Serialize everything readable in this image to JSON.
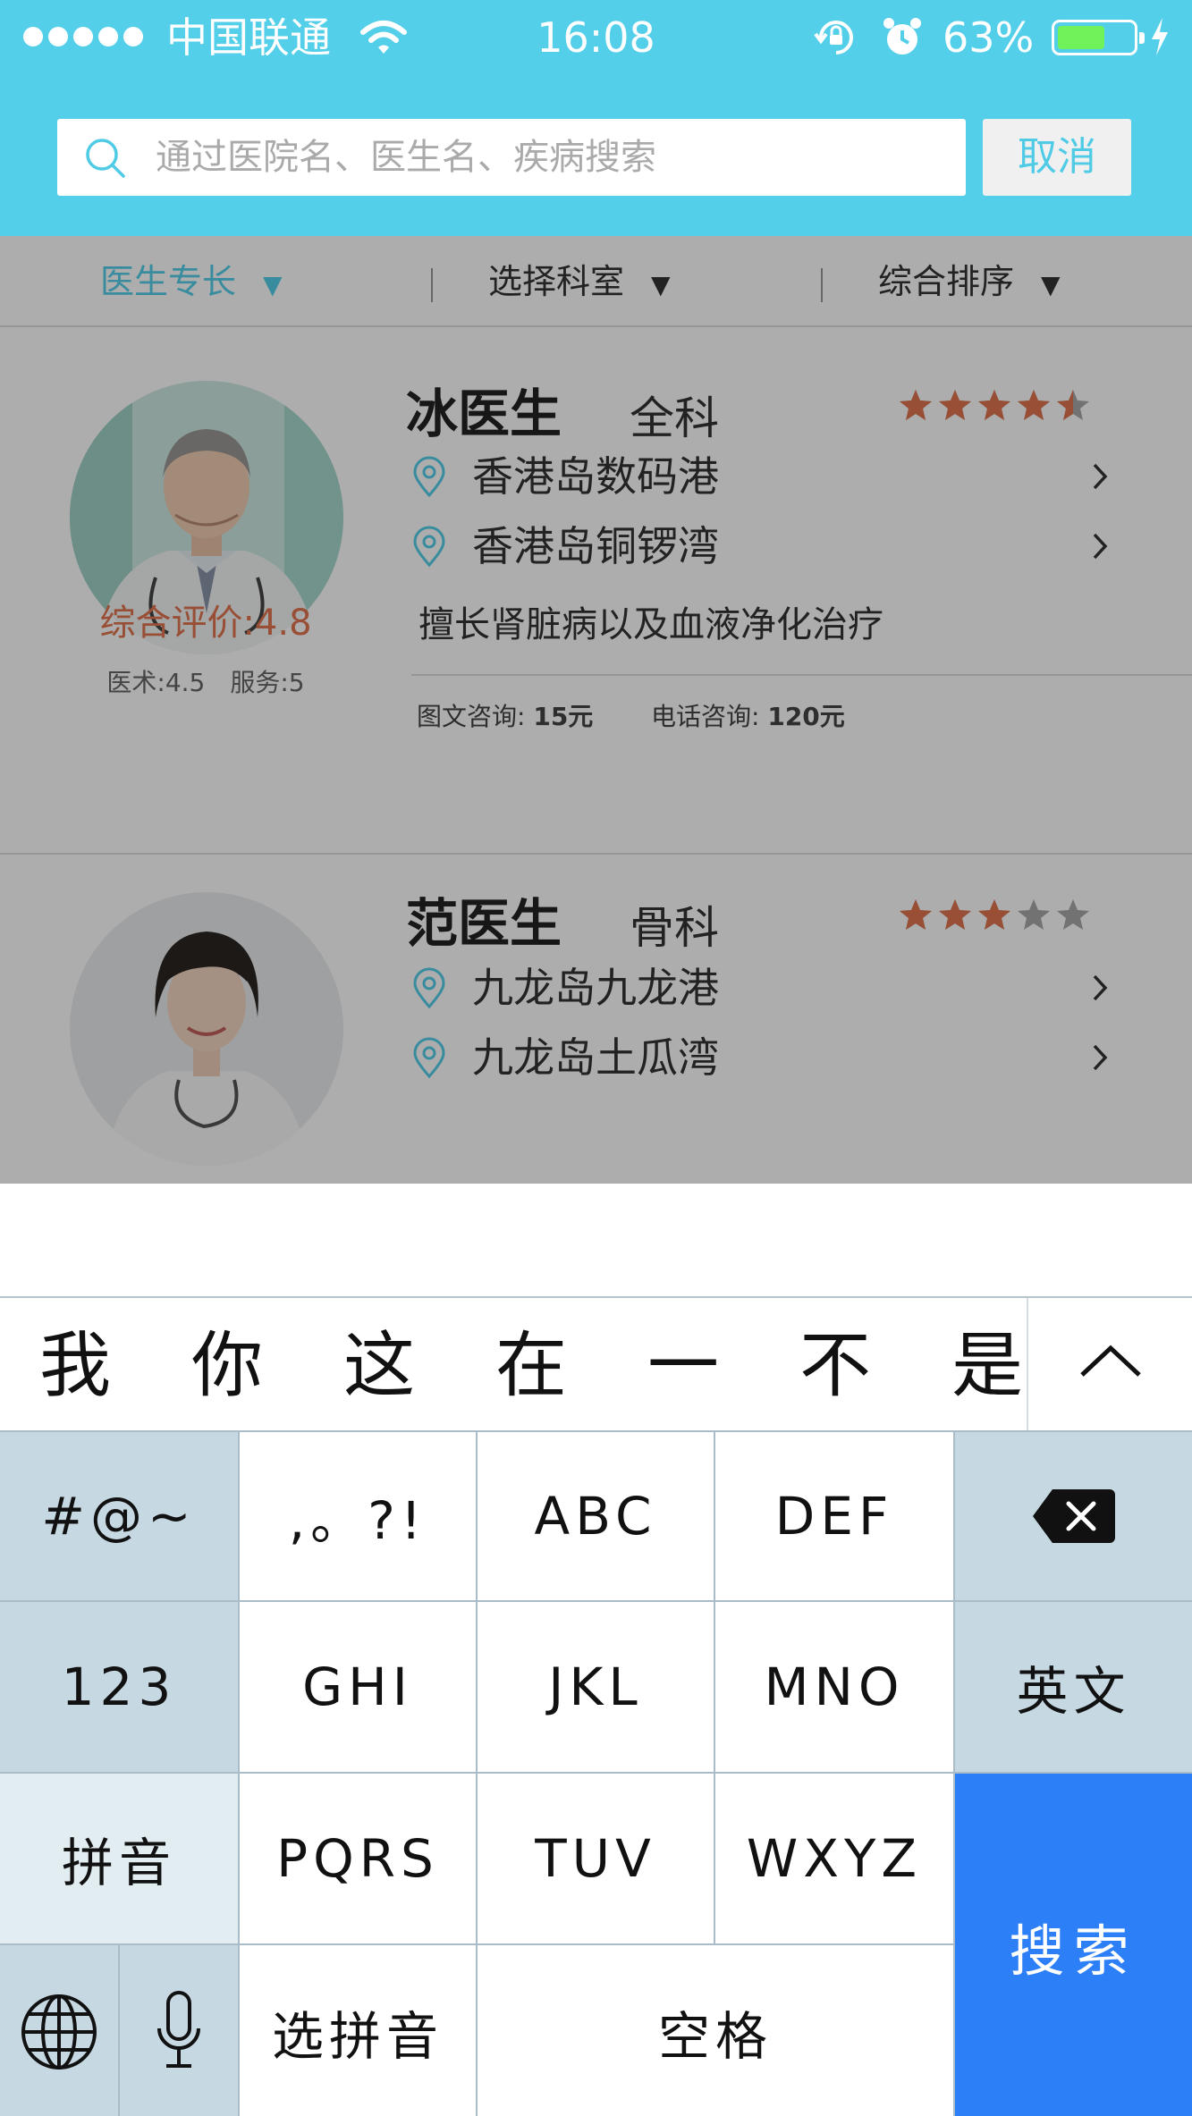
{
  "status_bar": {
    "carrier": "中国联通",
    "time": "16:08",
    "battery_percent": "63%",
    "battery_level": 0.63,
    "signal_bars": 5,
    "icons": [
      "signal-dots-icon",
      "wifi-icon",
      "rotation-lock-icon",
      "alarm-icon",
      "battery-icon",
      "charging-bolt-icon"
    ]
  },
  "search": {
    "placeholder": "通过医院名、医生名、疾病搜索",
    "cancel_label": "取消"
  },
  "filters": [
    {
      "label": "医生专长",
      "arrow": "▼",
      "active": true
    },
    {
      "label": "选择科室",
      "arrow": "▼",
      "active": false
    },
    {
      "label": "综合排序",
      "arrow": "▼",
      "active": false
    }
  ],
  "doctors": [
    {
      "name": "冰医生",
      "department": "全科",
      "stars": 4.5,
      "locations": [
        "香港岛数码港",
        "香港岛铜锣湾"
      ],
      "specialty": "擅长肾脏病以及血液净化治疗",
      "overall_rating": "综合评价:4.8",
      "sub_ratings": "医术:4.5　服务:5",
      "fees": {
        "text_label": "图文咨询: ",
        "text_price": "15元",
        "phone_label": "电话咨询: ",
        "phone_price": "120元"
      }
    },
    {
      "name": "范医生",
      "department": "骨科",
      "stars": 3,
      "locations": [
        "九龙岛九龙港",
        "九龙岛土瓜湾"
      ]
    }
  ],
  "keyboard": {
    "candidates": [
      "我",
      "你",
      "这",
      "在",
      "一",
      "不",
      "是"
    ],
    "rows": [
      [
        "#@~",
        ",。?!",
        "ABC",
        "DEF"
      ],
      [
        "123",
        "GHI",
        "JKL",
        "MNO",
        "英文"
      ],
      [
        "拼音",
        "PQRS",
        "TUV",
        "WXYZ"
      ]
    ],
    "bottom": {
      "pinyin_select": "选拼音",
      "space": "空格"
    },
    "search_label": "搜索",
    "colors": {
      "fn_key": "#c6d8e2",
      "search_key": "#2d7ff7",
      "header": "#54cfe9",
      "accent_rating": "#e0754f"
    }
  }
}
